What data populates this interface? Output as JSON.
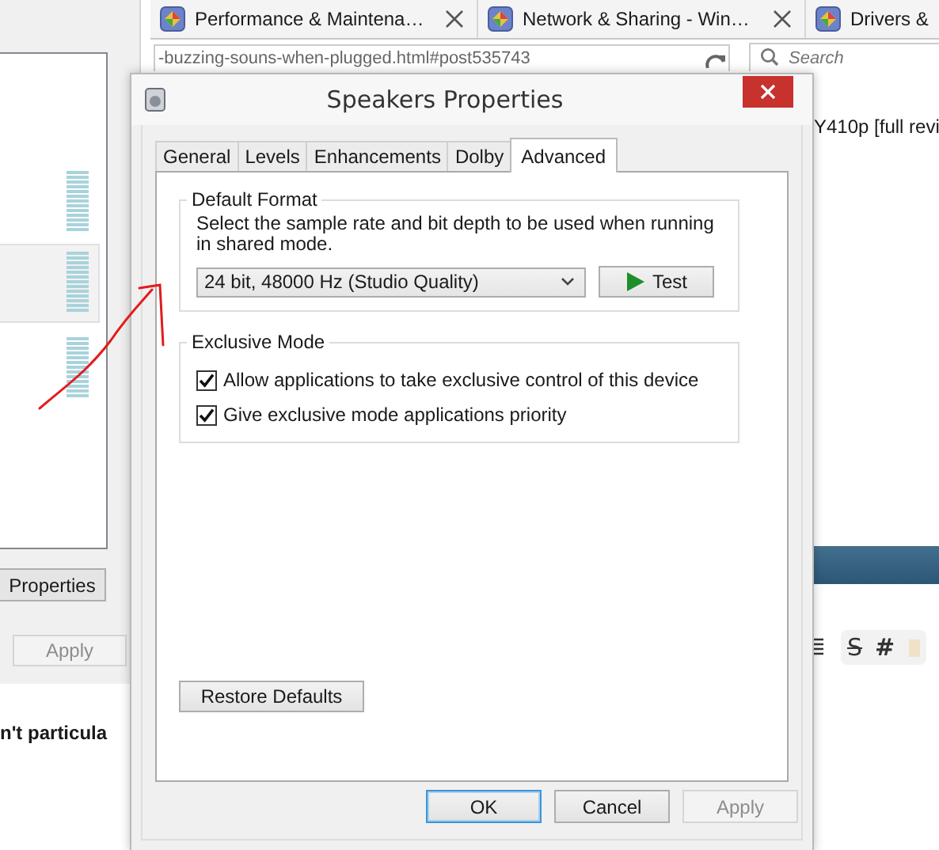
{
  "sound_panel": {
    "devices": [
      {
        "selected": false
      },
      {
        "selected": true
      },
      {
        "selected": false
      }
    ],
    "properties_button": "Properties",
    "apply_button": {
      "label": "Apply",
      "disabled": true
    },
    "post_text": "n't particula"
  },
  "browser": {
    "tabs": [
      {
        "label": "Performance & Maintena…"
      },
      {
        "label": "Network & Sharing - Win…"
      },
      {
        "label": "Drivers &"
      }
    ],
    "address": "-buzzing-souns-when-plugged.html#post535743",
    "search": {
      "placeholder": "Search"
    },
    "thread_title": "Y410p [full revi",
    "toolbar": [
      {
        "kind": "strike",
        "glyph": "S"
      },
      {
        "kind": "plain",
        "glyph": "#"
      }
    ]
  },
  "dialog": {
    "title": "Speakers Properties",
    "tabs": [
      {
        "label": "General",
        "selected": false
      },
      {
        "label": "Levels",
        "selected": false
      },
      {
        "label": "Enhancements",
        "selected": false
      },
      {
        "label": "Dolby",
        "selected": false
      },
      {
        "label": "Advanced",
        "selected": true
      }
    ],
    "default_format": {
      "heading": "Default Format",
      "description": "Select the sample rate and bit depth to be used when running in shared mode.",
      "value": "24 bit, 48000 Hz (Studio Quality)",
      "test_button": "Test"
    },
    "exclusive_mode": {
      "heading": "Exclusive Mode",
      "options": [
        {
          "label": "Allow applications to take exclusive control of this device",
          "checked": true
        },
        {
          "label": "Give exclusive mode applications priority",
          "checked": true
        }
      ]
    },
    "restore_button": "Restore Defaults",
    "buttons": [
      {
        "label": "OK",
        "default": true,
        "disabled": false
      },
      {
        "label": "Cancel",
        "default": false,
        "disabled": false
      },
      {
        "label": "Apply",
        "default": false,
        "disabled": true
      }
    ]
  }
}
